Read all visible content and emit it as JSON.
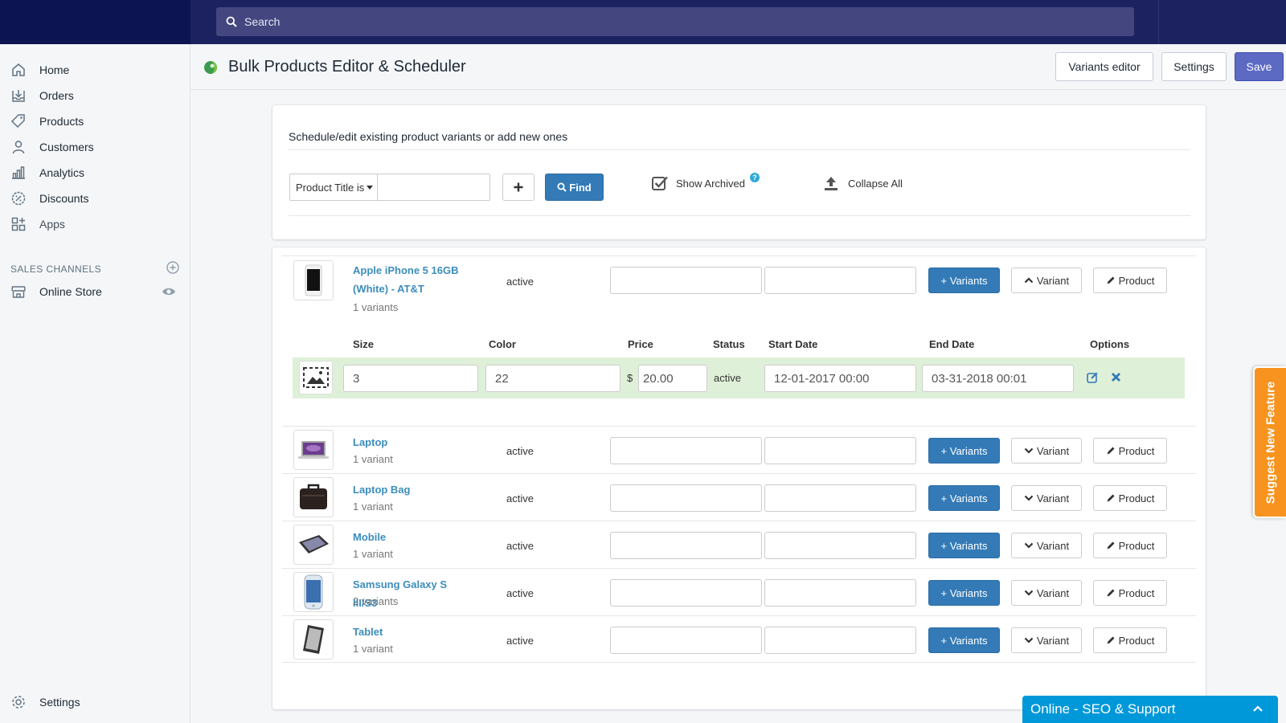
{
  "search": {
    "placeholder": "Search"
  },
  "sidebar": {
    "items": [
      {
        "label": "Home",
        "icon": "home-icon"
      },
      {
        "label": "Orders",
        "icon": "orders-icon"
      },
      {
        "label": "Products",
        "icon": "tag-icon"
      },
      {
        "label": "Customers",
        "icon": "person-icon"
      },
      {
        "label": "Analytics",
        "icon": "bar-chart-icon"
      },
      {
        "label": "Discounts",
        "icon": "discount-icon"
      },
      {
        "label": "Apps",
        "icon": "apps-icon"
      }
    ],
    "sales_channels_label": "SALES CHANNELS",
    "online_store_label": "Online Store",
    "settings_label": "Settings"
  },
  "header": {
    "title": "Bulk Products Editor & Scheduler",
    "variants_editor_label": "Variants editor",
    "settings_label": "Settings",
    "save_label": "Save"
  },
  "filter": {
    "description": "Schedule/edit existing product variants or add new ones",
    "select_value": "Product Title is",
    "find_label": "Find",
    "show_archived_label": "Show Archived",
    "collapse_all_label": "Collapse All"
  },
  "buttons": {
    "add_variants": "+ Variants",
    "variant": "Variant",
    "product": "Product"
  },
  "expanded_product": {
    "name": "Apple iPhone 5 16GB (White) - AT&T",
    "variants": "1 variants",
    "status": "active",
    "columns": [
      "Size",
      "Color",
      "Price",
      "Status",
      "Start Date",
      "End Date",
      "Options"
    ],
    "variant_row": {
      "size": "3",
      "color": "22",
      "currency": "$",
      "price": "20.00",
      "status": "active",
      "start_date": "12-01-2017 00:00",
      "end_date": "03-31-2018 00:01"
    }
  },
  "products": [
    {
      "name": "Laptop",
      "variants": "1 variant",
      "status": "active"
    },
    {
      "name": "Laptop Bag",
      "variants": "1 variant",
      "status": "active"
    },
    {
      "name": "Mobile",
      "variants": "1 variant",
      "status": "active"
    },
    {
      "name": "Samsung Galaxy S III/S3",
      "variants": "2 variants",
      "status": "active"
    },
    {
      "name": "Tablet",
      "variants": "1 variant",
      "status": "active"
    }
  ],
  "suggest_label": "Suggest New Feature",
  "chat_label": "Online - SEO & Support",
  "colors": {
    "accent": "#5c6ac4",
    "link": "#3c8dbc",
    "button_blue": "#337ab7",
    "topbar": "#1c2260",
    "suggest": "#f7931e",
    "chat": "#0098d8"
  }
}
